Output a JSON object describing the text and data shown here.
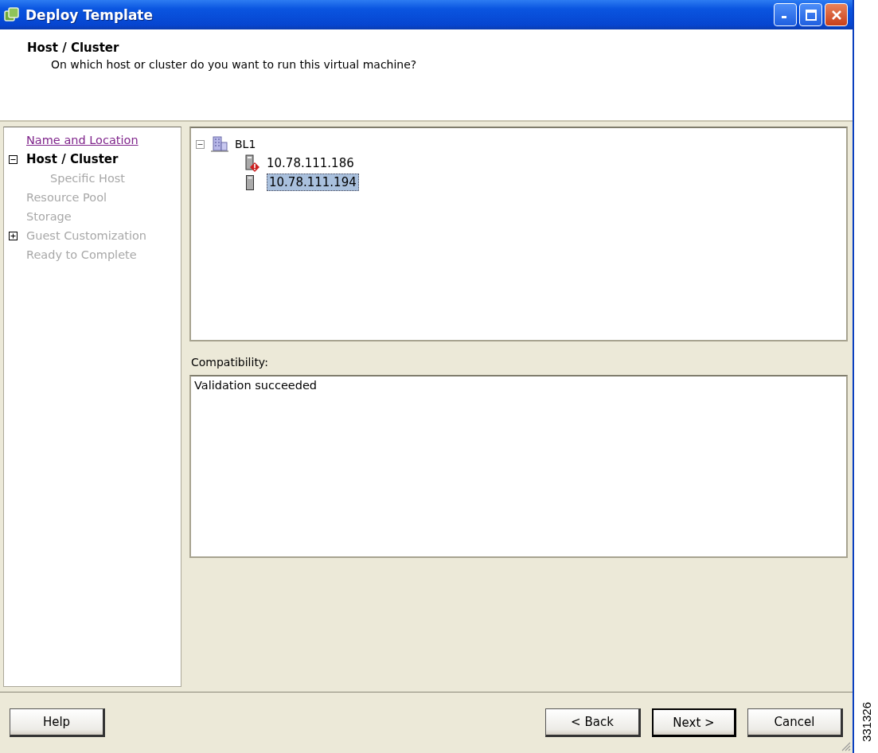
{
  "window": {
    "title": "Deploy Template"
  },
  "header": {
    "title": "Host / Cluster",
    "subtitle": "On which host or cluster do you want to run this virtual machine?"
  },
  "steps": [
    {
      "label": "Name and Location",
      "kind": "visited"
    },
    {
      "label": "Host / Cluster",
      "kind": "current",
      "expanded": true,
      "children": [
        {
          "label": "Specific Host",
          "kind": "pending"
        }
      ]
    },
    {
      "label": "Resource Pool",
      "kind": "pending"
    },
    {
      "label": "Storage",
      "kind": "pending"
    },
    {
      "label": "Guest Customization",
      "kind": "pending",
      "expanded": false
    },
    {
      "label": "Ready to Complete",
      "kind": "pending"
    }
  ],
  "tree": [
    {
      "label": "BL1",
      "expanded": true,
      "children": [
        {
          "label": "10.78.111.186",
          "warning": true,
          "selected": false
        },
        {
          "label": "10.78.111.194",
          "warning": false,
          "selected": true
        }
      ]
    }
  ],
  "compatibility": {
    "label": "Compatibility:",
    "text": "Validation succeeded"
  },
  "buttons": [
    {
      "label": "Help",
      "kind": "left",
      "default": false
    },
    {
      "label": "< Back",
      "kind": "right",
      "default": false
    },
    {
      "label": "Next >",
      "kind": "right",
      "default": true
    },
    {
      "label": "Cancel",
      "kind": "right",
      "default": false
    }
  ],
  "figure_number": "331326"
}
